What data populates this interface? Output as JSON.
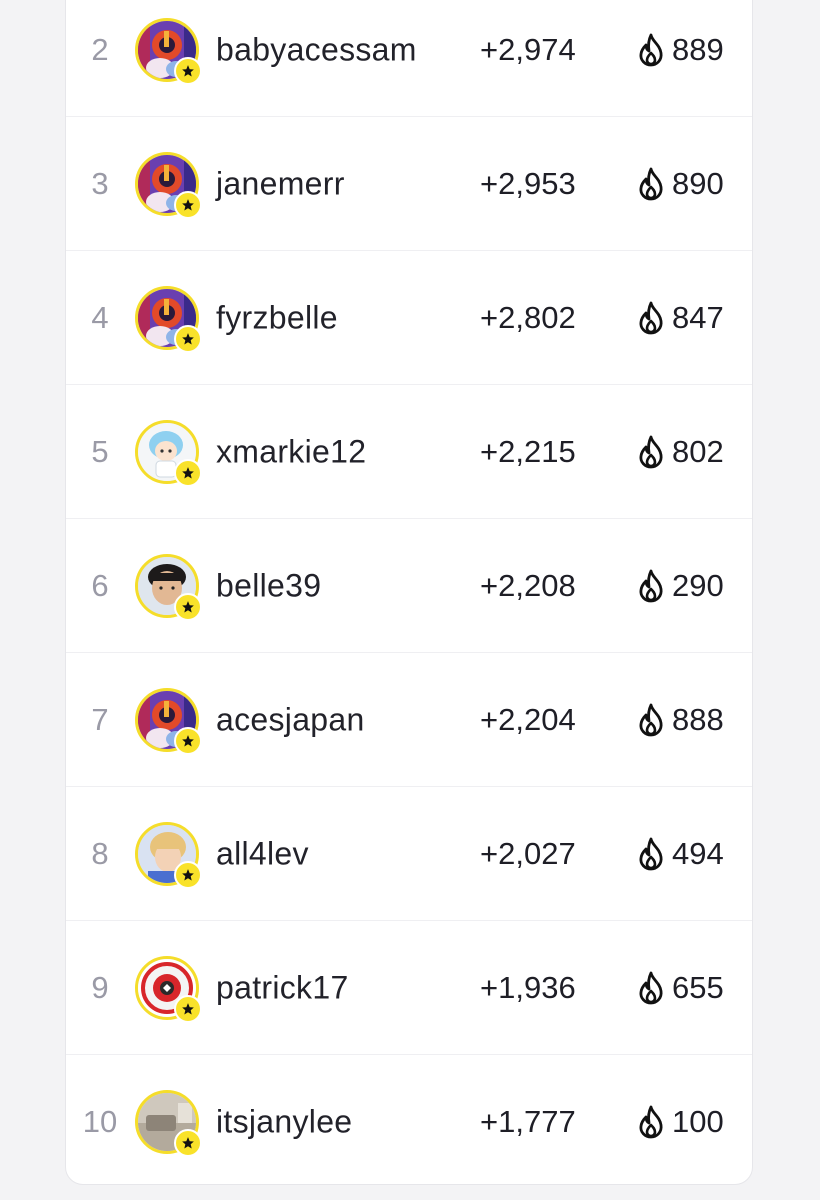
{
  "leaderboard": {
    "rows": [
      {
        "rank": "2",
        "username": "babyacessam",
        "points": "+2,974",
        "streak": "889",
        "avatar": "cartoon-purple"
      },
      {
        "rank": "3",
        "username": "janemerr",
        "points": "+2,953",
        "streak": "890",
        "avatar": "cartoon-purple"
      },
      {
        "rank": "4",
        "username": "fyrzbelle",
        "points": "+2,802",
        "streak": "847",
        "avatar": "cartoon-purple"
      },
      {
        "rank": "5",
        "username": "xmarkie12",
        "points": "+2,215",
        "streak": "802",
        "avatar": "anime-blue"
      },
      {
        "rank": "6",
        "username": "belle39",
        "points": "+2,208",
        "streak": "290",
        "avatar": "photo-boy"
      },
      {
        "rank": "7",
        "username": "acesjapan",
        "points": "+2,204",
        "streak": "888",
        "avatar": "cartoon-purple"
      },
      {
        "rank": "8",
        "username": "all4lev",
        "points": "+2,027",
        "streak": "494",
        "avatar": "photo-blonde"
      },
      {
        "rank": "9",
        "username": "patrick17",
        "points": "+1,936",
        "streak": "655",
        "avatar": "red-badge"
      },
      {
        "rank": "10",
        "username": "itsjanylee",
        "points": "+1,777",
        "streak": "100",
        "avatar": "photo-room"
      }
    ]
  },
  "icons": {
    "streak": "flame-icon",
    "badge": "star-icon"
  },
  "colors": {
    "avatar_ring": "#f5dd2a",
    "badge": "#f9e22a",
    "rank_text": "#9a9aa6",
    "text": "#1e1e26"
  }
}
